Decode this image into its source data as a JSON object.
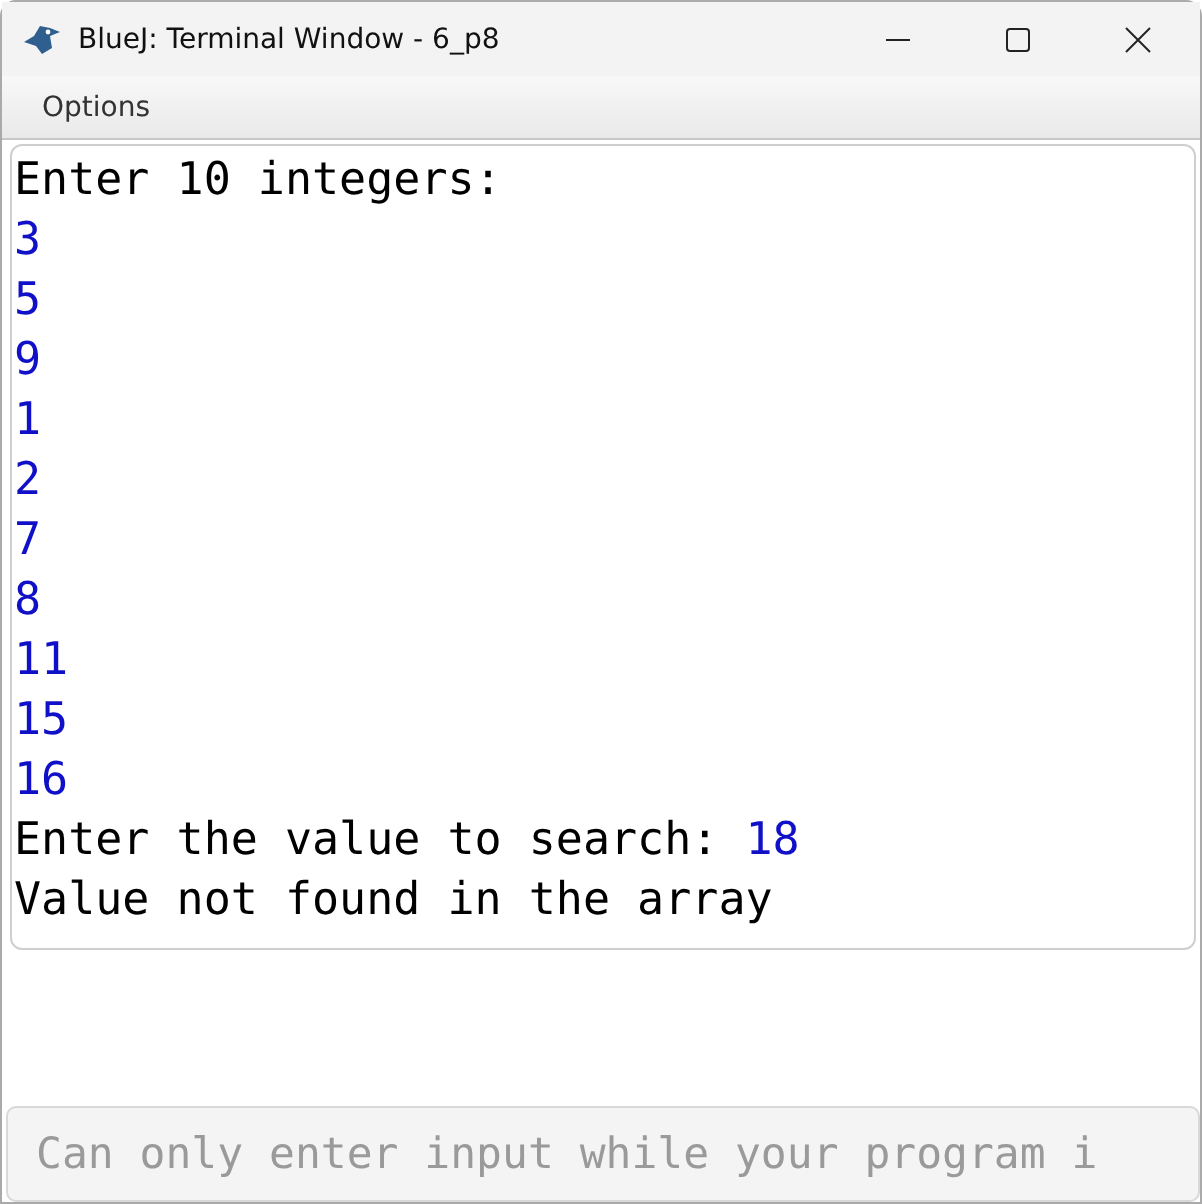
{
  "window": {
    "title": "BlueJ: Terminal Window - 6_p8"
  },
  "menu": [
    {
      "label": "Options"
    }
  ],
  "terminal": {
    "lines": [
      [
        {
          "kind": "output",
          "text": "Enter 10 integers:"
        }
      ],
      [
        {
          "kind": "input",
          "text": "3"
        }
      ],
      [
        {
          "kind": "input",
          "text": "5"
        }
      ],
      [
        {
          "kind": "input",
          "text": "9"
        }
      ],
      [
        {
          "kind": "input",
          "text": "1"
        }
      ],
      [
        {
          "kind": "input",
          "text": "2"
        }
      ],
      [
        {
          "kind": "input",
          "text": "7"
        }
      ],
      [
        {
          "kind": "input",
          "text": "8"
        }
      ],
      [
        {
          "kind": "input",
          "text": "11"
        }
      ],
      [
        {
          "kind": "input",
          "text": "15"
        }
      ],
      [
        {
          "kind": "input",
          "text": "16"
        }
      ],
      [
        {
          "kind": "output",
          "text": "Enter the value to search: "
        },
        {
          "kind": "input",
          "text": "18"
        }
      ],
      [
        {
          "kind": "output",
          "text": "Value not found in the array"
        }
      ]
    ]
  },
  "input_field": {
    "placeholder": "Can only enter input while your program i",
    "disabled": true
  }
}
